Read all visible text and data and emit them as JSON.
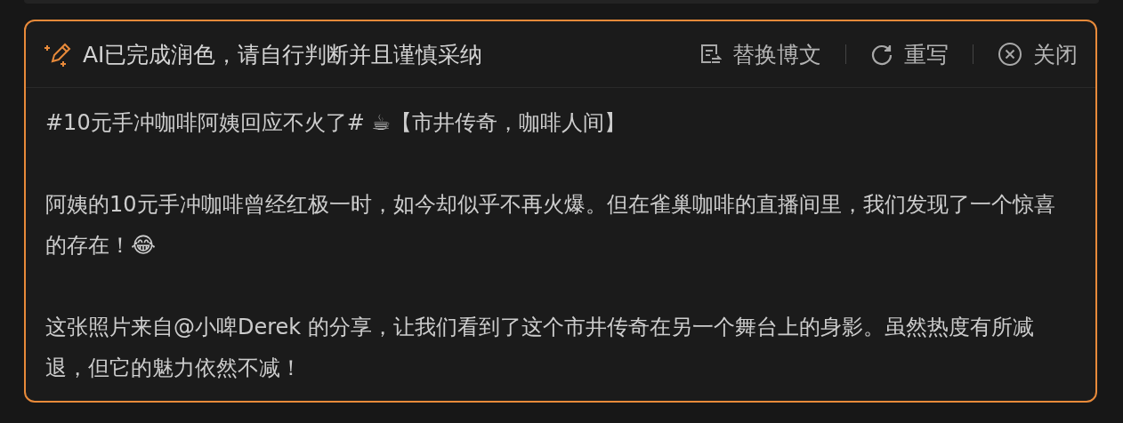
{
  "header": {
    "title": "AI已完成润色，请自行判断并且谨慎采纳",
    "actions": [
      {
        "kind": "replace",
        "label": "替换博文"
      },
      {
        "kind": "rewrite",
        "label": "重写"
      },
      {
        "kind": "close",
        "label": "关闭"
      }
    ]
  },
  "paragraphs": [
    [
      "#10元手冲咖啡阿姨回应不火了# ☕【市井传奇，咖啡人间】"
    ],
    [
      "阿姨的10元手冲咖啡曾经红极一时，如今却似乎不再火爆。但在雀巢咖啡的直播间里，我们发现了一个惊喜的存在！😂"
    ],
    [
      "这张照片来自@小啤Derek 的分享，让我们看到了这个市井传奇在另一个舞台上的身影。虽然热度有所减退，但它的魅力依然不减！"
    ]
  ]
}
